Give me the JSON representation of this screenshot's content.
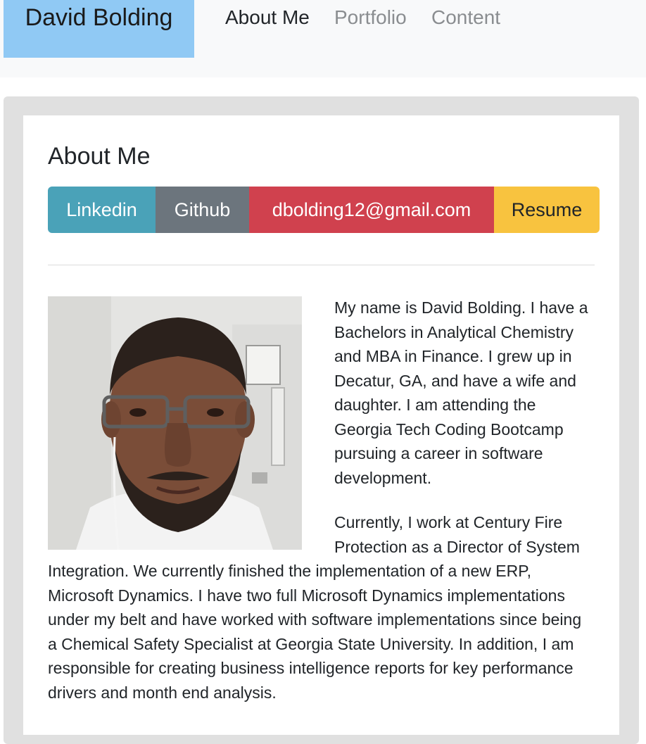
{
  "navbar": {
    "brand": "David Bolding",
    "links": [
      {
        "label": "About Me",
        "active": true
      },
      {
        "label": "Portfolio",
        "active": false
      },
      {
        "label": "Content",
        "active": false
      }
    ]
  },
  "about": {
    "title": "About Me",
    "buttons": {
      "linkedin": "Linkedin",
      "github": "Github",
      "email": "dbolding12@gmail.com",
      "resume": "Resume"
    },
    "paragraphs": [
      "My name is David Bolding. I have a Bachelors in Analytical Chemistry and MBA in Finance. I grew up in Decatur, GA, and have a wife and daughter. I am attending the Georgia Tech Coding Bootcamp pursuing a career in software development.",
      "Currently, I work at Century Fire Protection as a Director of System Integration. We currently finished the implementation of a new ERP, Microsoft Dynamics. I have two full Microsoft Dynamics implementations under my belt and have worked with software implementations since being a Chemical Safety Specialist at Georgia State University. In addition, I am responsible for creating business intelligence reports for key performance drivers and month end analysis."
    ]
  },
  "colors": {
    "brand_bg": "#90c9f4",
    "linkedin": "#4aa2b8",
    "github": "#6c757d",
    "email": "#d0414e",
    "resume": "#f8c33f"
  }
}
